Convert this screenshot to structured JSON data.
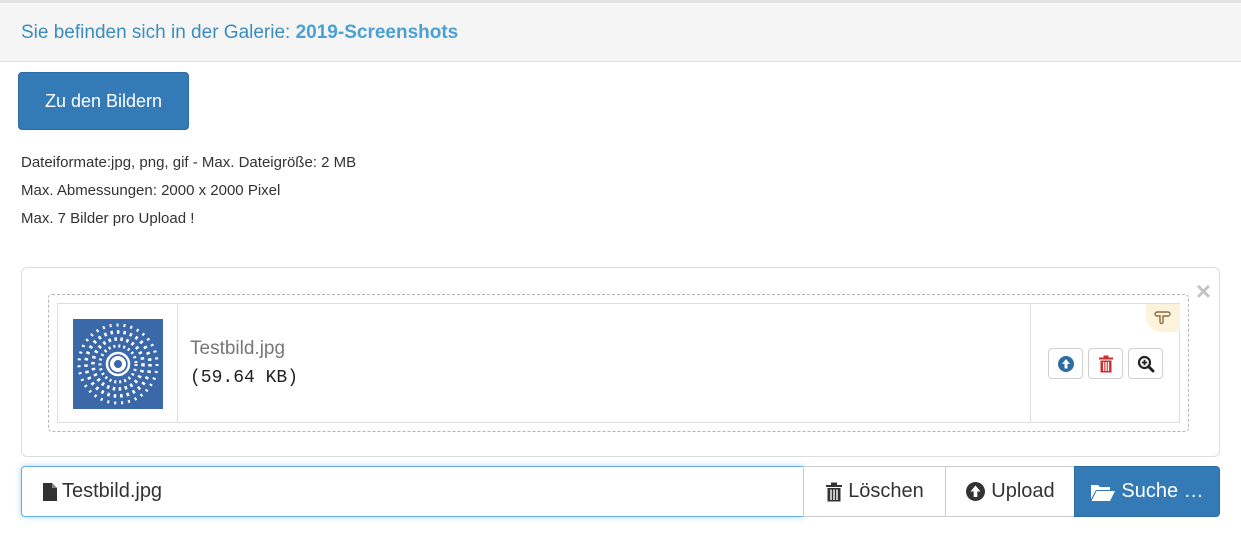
{
  "header": {
    "prefix": "Sie befinden sich in der Galerie:",
    "gallery": "2019-Screenshots"
  },
  "back_button": {
    "label": "Zu den Bildern"
  },
  "info": [
    "Dateiformate:jpg, png, gif - Max. Dateigröße: 2 MB",
    "Max. Abmessungen: 2000 x 2000 Pixel",
    "Max. 7 Bilder pro Upload !"
  ],
  "preview": {
    "close_glyph": "×",
    "file": {
      "name": "Testbild.jpg",
      "size": "(59.64 KB)"
    },
    "icons": {
      "upload": "circle-arrow-up-icon",
      "remove": "trash-icon",
      "zoom": "zoom-in-icon",
      "drag": "hand-pointer-icon"
    }
  },
  "input_bar": {
    "caption": "Testbild.jpg",
    "remove_label": "Löschen",
    "upload_label": "Upload",
    "browse_label": "Suche …"
  },
  "colors": {
    "primary": "#337ab7",
    "header_link": "#3a8cc1",
    "remove_icon": "#c9302c"
  }
}
